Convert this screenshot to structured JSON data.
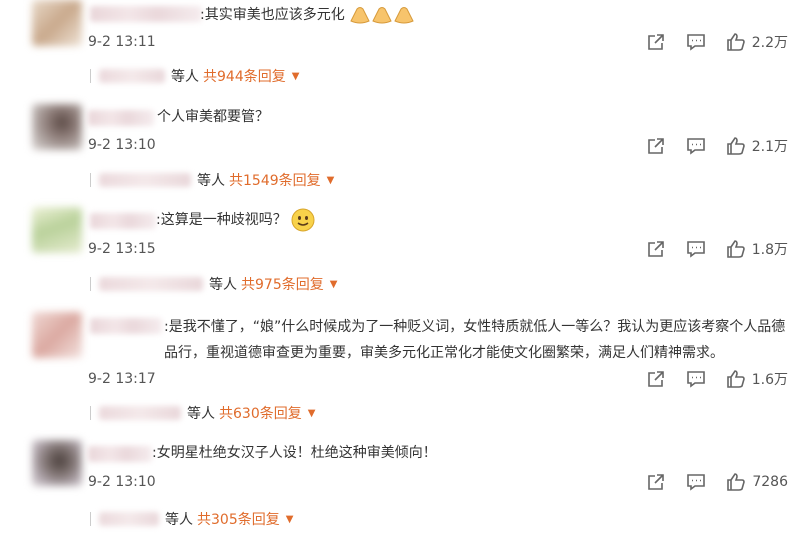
{
  "comments": [
    {
      "text": ":其实审美也应该多元化",
      "emoji": [
        "hands-icon",
        "hands-icon",
        "hands-icon"
      ],
      "time": "9-2 13:11",
      "likes": "2.2万",
      "reply_prefix": "等人",
      "reply_count": "共944条回复"
    },
    {
      "text": "个人审美都要管？",
      "time": "9-2 13:10",
      "likes": "2.1万",
      "reply_prefix": "等人",
      "reply_count": "共1549条回复"
    },
    {
      "text": ":这算是一种歧视吗？",
      "emoji": [
        "smile-icon"
      ],
      "time": "9-2 13:15",
      "likes": "1.8万",
      "reply_prefix": "等人",
      "reply_count": "共975条回复"
    },
    {
      "text": ":是我不懂了，“娘”什么时候成为了一种贬义词，女性特质就低人一等么？我认为更应该考察个人品德品行，重视道德审查更为重要，审美多元化正常化才能使文化圈繁荣，满足人们精神需求。",
      "time": "9-2 13:17",
      "likes": "1.6万",
      "reply_prefix": "等人",
      "reply_count": "共630条回复"
    },
    {
      "text": ":女明星杜绝女汉子人设！杜绝这种审美倾向！",
      "time": "9-2 13:10",
      "likes": "7286",
      "reply_prefix": "等人",
      "reply_count": "共305条回复"
    }
  ]
}
